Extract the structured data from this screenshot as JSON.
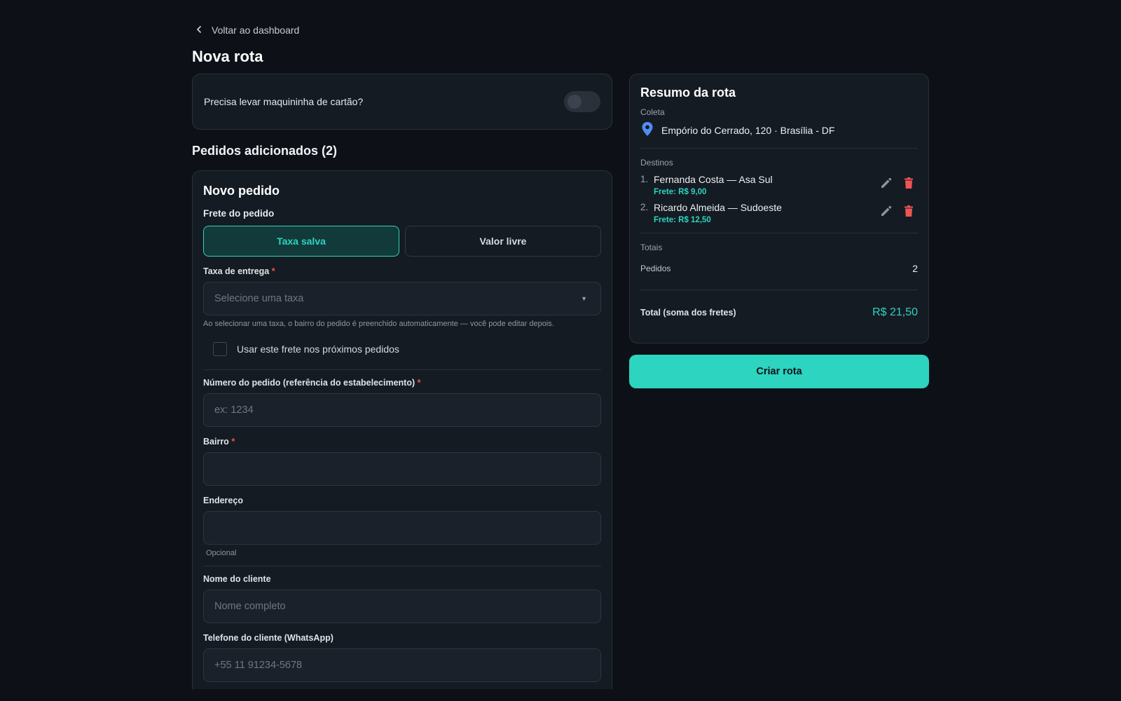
{
  "nav": {
    "back_label": "Voltar ao dashboard"
  },
  "page": {
    "title": "Nova rota"
  },
  "card_machine": {
    "label": "Precisa levar maquininha de cartão?",
    "enabled": false
  },
  "orders_section": {
    "title": "Pedidos adicionados (2)"
  },
  "new_order": {
    "title": "Novo pedido",
    "freight_label": "Frete do pedido",
    "freight_options": [
      "Taxa salva",
      "Valor livre"
    ],
    "freight_selected": "Taxa salva",
    "fee_label": "Taxa de entrega",
    "fee_placeholder": "Selecione uma taxa",
    "fee_hint": "Ao selecionar uma taxa, o bairro do pedido é preenchido automaticamente — você pode editar depois.",
    "reuse_label": "Usar este frete nos próximos pedidos",
    "order_number_label": "Número do pedido (referência do estabelecimento)",
    "order_number_placeholder": "ex: 1234",
    "neighborhood_label": "Bairro",
    "neighborhood_value": "",
    "address_label": "Endereço",
    "address_value": "",
    "address_hint": "Opcional",
    "client_name_label": "Nome do cliente",
    "client_name_placeholder": "Nome completo",
    "client_phone_label": "Telefone do cliente (WhatsApp)",
    "client_phone_placeholder": "+55 11 91234-5678",
    "required_mark": "*"
  },
  "summary": {
    "title": "Resumo da rota",
    "pickup_label": "Coleta",
    "pickup_address": "Empório do Cerrado, 120 · Brasília - DF",
    "destinations_label": "Destinos",
    "destinations": [
      {
        "num": "1.",
        "name": "Fernanda Costa — Asa Sul",
        "fee": "Frete: R$ 9,00"
      },
      {
        "num": "2.",
        "name": "Ricardo Almeida — Sudoeste",
        "fee": "Frete: R$ 12,50"
      }
    ],
    "totals_label": "Totais",
    "orders_label": "Pedidos",
    "orders_count": "2",
    "total_label": "Total (soma dos fretes)",
    "total_value": "R$ 21,50"
  },
  "create_button": "Criar rota",
  "colors": {
    "accent": "#2dd4bf",
    "danger": "#f05454",
    "background": "#0d1117",
    "card": "#151b23"
  },
  "icons": [
    "chevron-left-icon",
    "map-pin-icon",
    "pencil-icon",
    "trash-icon",
    "caret-down-icon"
  ]
}
